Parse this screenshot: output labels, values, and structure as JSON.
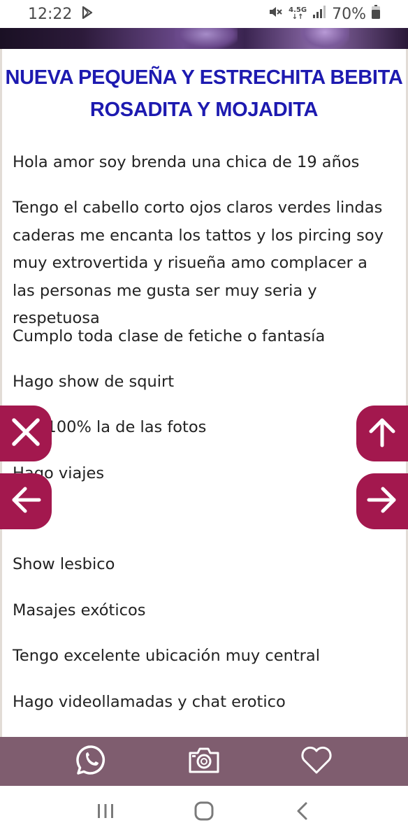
{
  "status_bar": {
    "time": "12:22",
    "network": "4.5G",
    "battery": "70%"
  },
  "icons": {
    "play_store": "play-store-icon",
    "mute": "mute-vibrate-icon",
    "signal": "signal-bars-icon",
    "battery": "battery-icon",
    "close": "close-icon",
    "back_arrow": "arrow-left-icon",
    "up_arrow": "arrow-up-icon",
    "forward_arrow": "arrow-right-icon",
    "whatsapp": "whatsapp-icon",
    "camera": "camera-icon",
    "heart": "heart-icon",
    "recents": "recents-icon",
    "home": "home-icon",
    "back": "back-icon"
  },
  "colors": {
    "title": "#1d1ab0",
    "fab": "#a3184e",
    "action_bar": "#7f5d6f"
  },
  "post": {
    "title": "NUEVA PEQUEÑA Y ESTRECHITA BEBITA ROSADITA Y MOJADITA",
    "paragraphs": [
      "Hola amor soy brenda una chica de 19 años",
      "Tengo el cabello corto ojos claros verdes lindas caderas me encanta los tattos y los pircing soy muy extrovertida y risueña amo complacer a las personas me gusta ser muy seria y respetuosa",
      "Cumplo toda clase de fetiche o fantasía",
      "Hago show de squirt",
      "Soy 100% la de las fotos",
      "Hago viajes",
      "Trios",
      "Show lesbico",
      "Masajes exóticos",
      "Tengo excelente ubicación muy central",
      "Hago videollamadas y chat erotico"
    ]
  }
}
